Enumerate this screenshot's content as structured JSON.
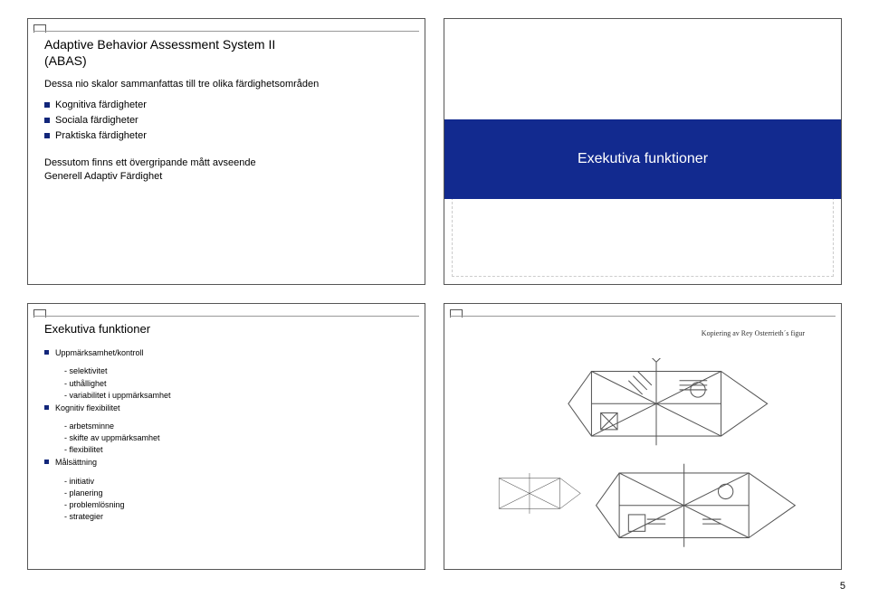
{
  "slide1": {
    "title_line1": "Adaptive Behavior Assessment System II",
    "title_line2": "(ABAS)",
    "intro": "Dessa nio skalor sammanfattas till tre olika färdighetsområden",
    "bullets": [
      "Kognitiva färdigheter",
      "Sociala färdigheter",
      "Praktiska färdigheter"
    ],
    "footer_line1": "Dessutom finns ett övergripande mått avseende",
    "footer_line2": "Generell Adaptiv Färdighet"
  },
  "slide2": {
    "title": "Exekutiva funktioner"
  },
  "slide3": {
    "title": "Exekutiva funktioner",
    "items": [
      {
        "label": "Uppmärksamhet/kontroll",
        "subs": [
          "- selektivitet",
          "- uthållighet",
          "- variabilitet i uppmärksamhet"
        ]
      },
      {
        "label": "Kognitiv flexibilitet",
        "subs": [
          "- arbetsminne",
          "- skifte av uppmärksamhet",
          "- flexibilitet"
        ]
      },
      {
        "label": "Målsättning",
        "subs": [
          "- initiativ",
          "- planering",
          "- problemlösning",
          "- strategier"
        ]
      }
    ]
  },
  "slide4": {
    "caption": "Kopiering av Rey Osterrieth´s figur"
  },
  "page_number": "5"
}
